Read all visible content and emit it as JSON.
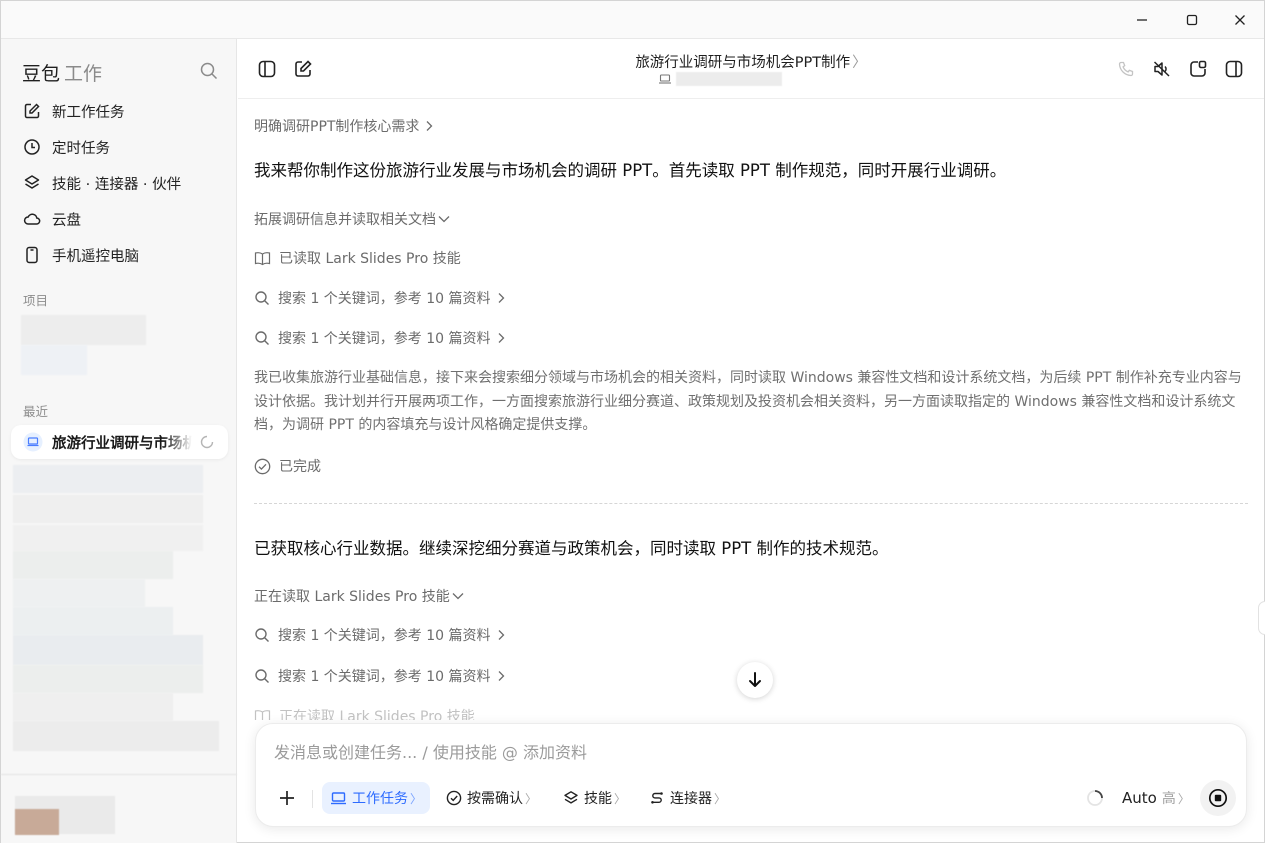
{
  "window": {
    "minimize_icon": "minimize-icon",
    "maximize_icon": "maximize-icon",
    "close_icon": "close-icon"
  },
  "sidebar": {
    "brand_name": "豆包",
    "brand_sub": "工作",
    "nav": [
      {
        "label": "新工作任务",
        "icon": "edit-icon"
      },
      {
        "label": "定时任务",
        "icon": "clock-icon"
      },
      {
        "label": "技能 · 连接器 · 伙伴",
        "icon": "layers-icon"
      },
      {
        "label": "云盘",
        "icon": "cloud-icon"
      },
      {
        "label": "手机遥控电脑",
        "icon": "phone-icon"
      }
    ],
    "projects_label": "项目",
    "recent_label": "最近",
    "recent_active": "旅游行业调研与市场机会PPT制作"
  },
  "header": {
    "title": "旅游行业调研与市场机会PPT制作",
    "title_chevron": "〉"
  },
  "content": {
    "step1_title": "明确调研PPT制作核心需求",
    "lead1": "我来帮你制作这份旅游行业发展与市场机会的调研 PPT。首先读取 PPT 制作规范，同时开展行业调研。",
    "group1_title": "拓展调研信息并读取相关文档",
    "g1_read": "已读取 Lark Slides Pro 技能",
    "g1_search1": "搜索 1 个关键词，参考 10 篇资料",
    "g1_search2": "搜索 1 个关键词，参考 10 篇资料",
    "g1_para": "我已收集旅游行业基础信息，接下来会搜索细分领域与市场机会的相关资料，同时读取 Windows 兼容性文档和设计系统文档，为后续 PPT 制作补充专业内容与设计依据。我计划并行开展两项工作，一方面搜索旅游行业细分赛道、政策规划及投资机会相关资料，另一方面读取指定的 Windows 兼容性文档和设计系统文档，为调研 PPT 的内容填充与设计风格确定提供支撑。",
    "g1_done": "已完成",
    "lead2": "已获取核心行业数据。继续深挖细分赛道与政策机会，同时读取 PPT 制作的技术规范。",
    "group2_title": "正在读取 Lark Slides Pro 技能",
    "g2_search1": "搜索 1 个关键词，参考 10 篇资料",
    "g2_search2": "搜索 1 个关键词，参考 10 篇资料",
    "g2_fading": "正在读取 Lark Slides Pro 技能"
  },
  "composer": {
    "placeholder": "发消息或创建任务... / 使用技能 @ 添加资料",
    "work_task": "工作任务",
    "confirm": "按需确认",
    "skills": "技能",
    "connectors": "连接器",
    "model": "Auto",
    "level": "高",
    "accent_color": "#2d6bff"
  }
}
